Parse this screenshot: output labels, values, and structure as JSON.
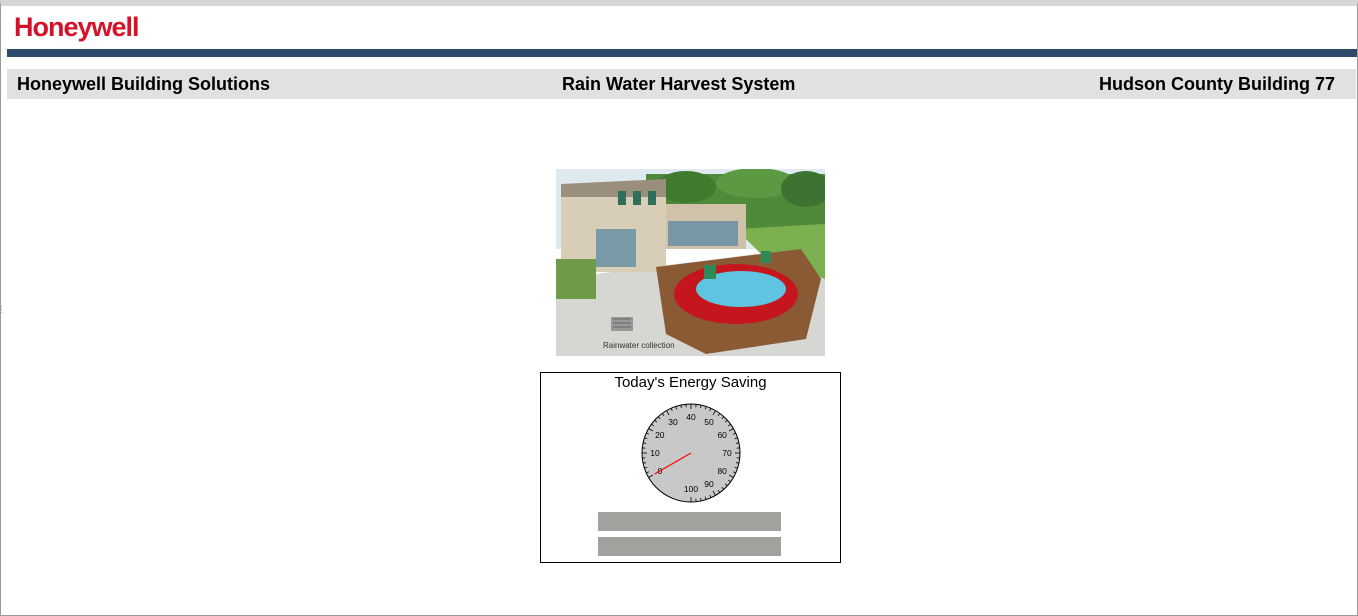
{
  "brand": {
    "logo_text": "Honeywell",
    "logo_color": "#d4122a",
    "rule_color": "#2e4a6b"
  },
  "header": {
    "left": "Honeywell Building Solutions",
    "center": "Rain Water Harvest System",
    "right": "Hudson County Building 77"
  },
  "illustration": {
    "caption": "Rainwater collection"
  },
  "energy_panel": {
    "title": "Today's Energy Saving",
    "gauge": {
      "min": 0,
      "max": 100,
      "tick_labels": [
        "0",
        "10",
        "20",
        "30",
        "40",
        "50",
        "60",
        "70",
        "80",
        "90",
        "100"
      ],
      "value": 0,
      "needle_color": "#ff0000"
    },
    "bars": [
      {
        "text": ""
      },
      {
        "text": ""
      }
    ]
  }
}
